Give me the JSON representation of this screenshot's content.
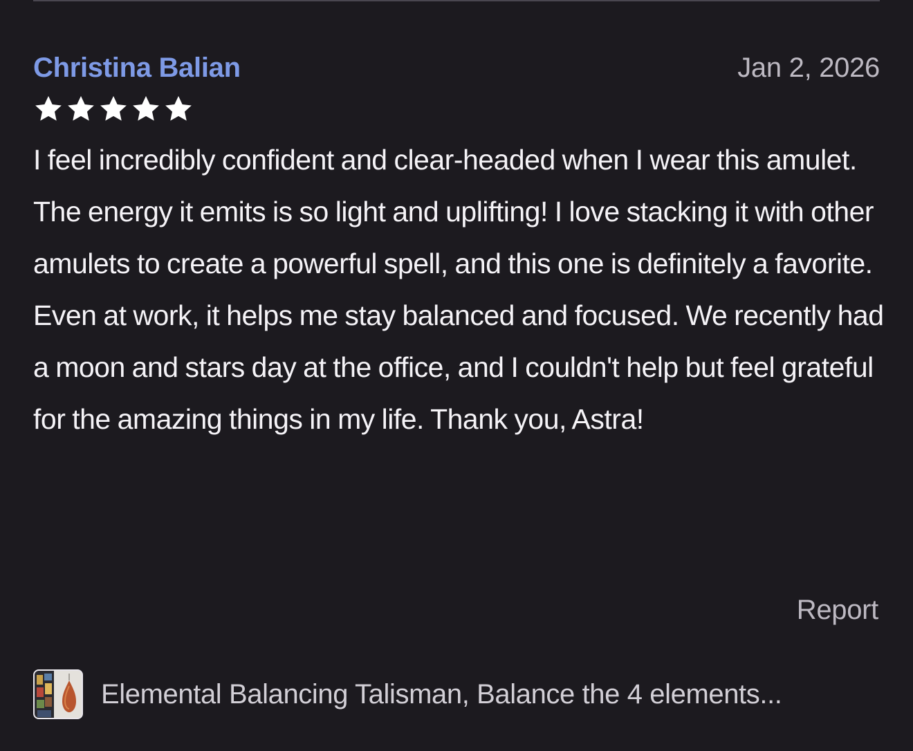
{
  "review": {
    "reviewer_name": "Christina Balian",
    "date": "Jan 2, 2026",
    "rating": 5,
    "rating_max": 5,
    "body": "I feel incredibly confident and clear-headed when I wear this amulet. The energy it emits is so light and uplifting! I love stacking it with other amulets to create a powerful spell, and this one is definitely a favorite. Even at work, it helps me stay balanced and focused. We recently had a moon and stars day at the office, and I couldn't help but feel grateful for the amazing things in my life. Thank you, Astra!",
    "report_label": "Report"
  },
  "product": {
    "title": "Elemental Balancing Talisman, Balance the 4 elements...",
    "thumbnail_icon": "product-thumbnail"
  },
  "colors": {
    "background": "#1c1a1f",
    "reviewer_name": "#7e9ae6",
    "muted_text": "#bdb9c2",
    "body_text": "#f5f3f7",
    "star": "#ffffff"
  }
}
